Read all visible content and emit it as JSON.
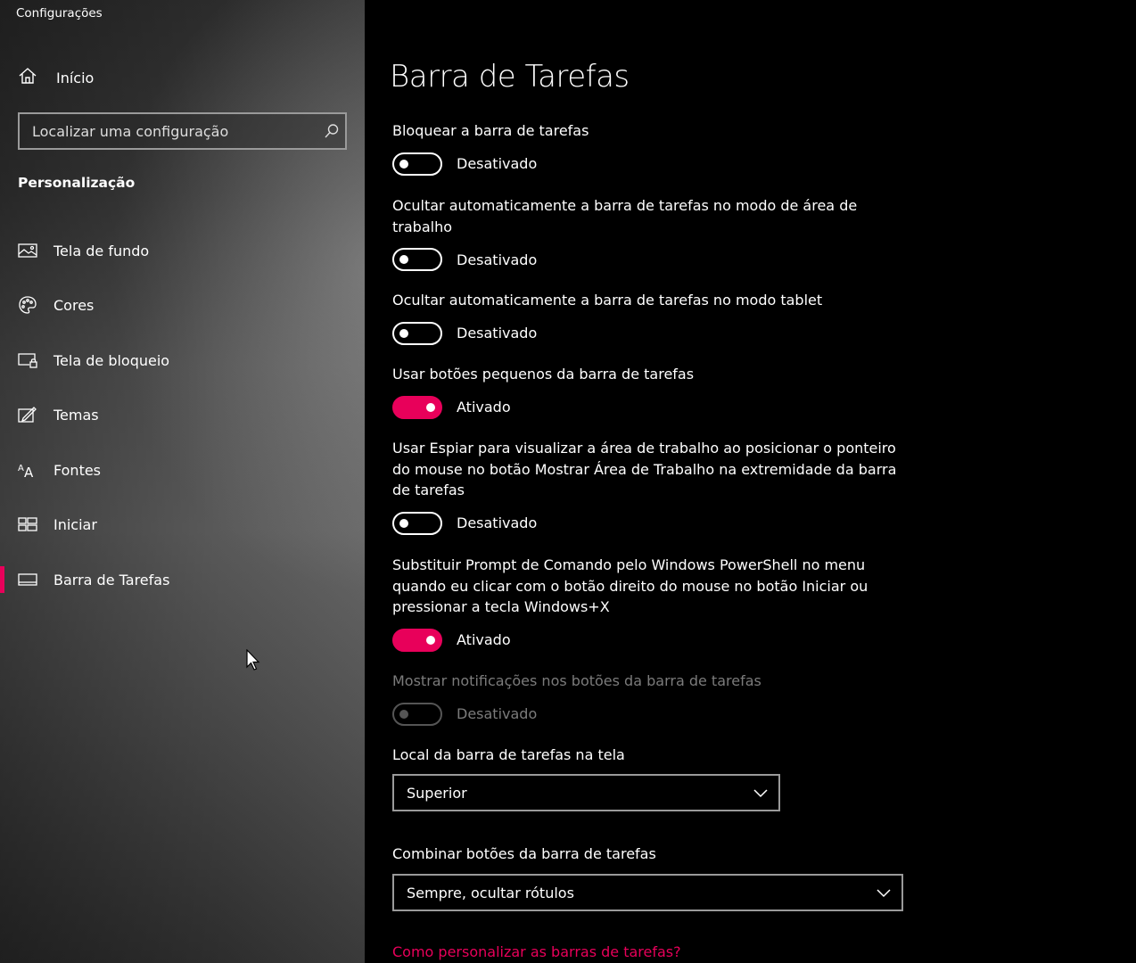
{
  "app": {
    "title": "Configurações"
  },
  "sidebar": {
    "home_label": "Início",
    "search": {
      "placeholder": "Localizar uma configuração"
    },
    "section_title": "Personalização",
    "items": [
      {
        "label": "Tela de fundo",
        "icon": "picture-icon"
      },
      {
        "label": "Cores",
        "icon": "palette-icon"
      },
      {
        "label": "Tela de bloqueio",
        "icon": "lock-screen-icon"
      },
      {
        "label": "Temas",
        "icon": "themes-icon"
      },
      {
        "label": "Fontes",
        "icon": "fonts-icon"
      },
      {
        "label": "Iniciar",
        "icon": "start-icon"
      },
      {
        "label": "Barra de Tarefas",
        "icon": "taskbar-icon",
        "active": true
      }
    ]
  },
  "main": {
    "title": "Barra de Tarefas",
    "settings": [
      {
        "label": "Bloquear a barra de tarefas",
        "state": "Desativado",
        "on": false
      },
      {
        "label": "Ocultar automaticamente a barra de tarefas no modo de área de trabalho",
        "state": "Desativado",
        "on": false
      },
      {
        "label": "Ocultar automaticamente a barra de tarefas no modo tablet",
        "state": "Desativado",
        "on": false
      },
      {
        "label": "Usar botões pequenos da barra de tarefas",
        "state": "Ativado",
        "on": true
      },
      {
        "label": "Usar Espiar para visualizar a área de trabalho ao posicionar o ponteiro do mouse no botão Mostrar Área de Trabalho na extremidade da barra de tarefas",
        "state": "Desativado",
        "on": false
      },
      {
        "label": "Substituir Prompt de Comando pelo Windows PowerShell no menu quando eu clicar com o botão direito do mouse no botão Iniciar ou pressionar a tecla Windows+X",
        "state": "Ativado",
        "on": true
      },
      {
        "label": "Mostrar notificações nos botões da barra de tarefas",
        "state": "Desativado",
        "on": false,
        "disabled": true
      }
    ],
    "location": {
      "label": "Local da barra de tarefas na tela",
      "value": "Superior"
    },
    "combine": {
      "label": "Combinar botões da barra de tarefas",
      "value": "Sempre, ocultar rótulos"
    },
    "help_link": "Como personalizar as barras de tarefas?"
  },
  "colors": {
    "accent": "#e8005a",
    "background": "#000000"
  }
}
